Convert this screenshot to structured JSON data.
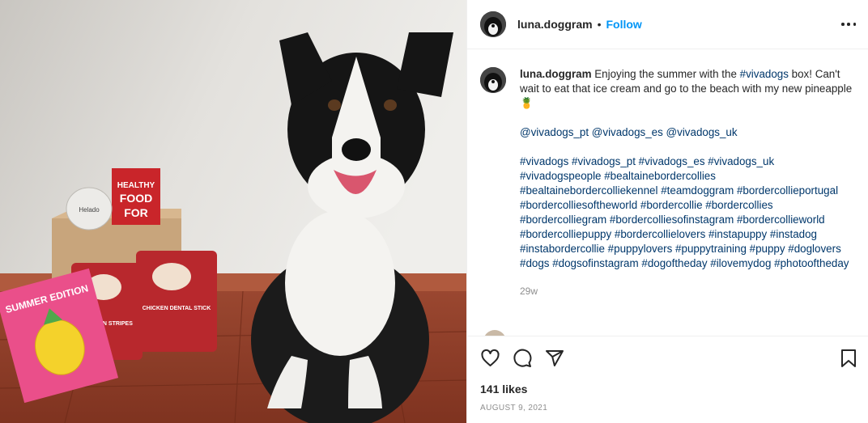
{
  "post": {
    "username": "luna.doggram",
    "separator": "•",
    "follow_label": "Follow",
    "more_label": "More options"
  },
  "caption": {
    "username": "luna.doggram",
    "text": " Enjoying the summer with the ",
    "hashtag_box": "#vivadogs",
    "text2": " box! Can't wait to eat that ice cream and go to the beach with my new pineapple 🍍",
    "mentions": "@vivadogs_pt @vivadogs_es @vivadogs_uk",
    "hashtags": "#vivadogs #vivadogs_pt #vivadogs_es #vivadogs_uk #vivadogspeople #bealtainebordercollies #bealtainebordercolliekennel #teamdoggram #bordercollieportugal #bordercolliesoftheworld #bordercollie #bordercollies #bordercolliegram #bordercolliesofinstagram #bordercollieworld #bordercolliepuppy #bordercollielovers #instapuppy #instadog #instabordercollie #puppylovers #puppytraining #puppy #doglovers #dogs #dogsofinstagram #dogoftheday #ilovemydog #photooftheday",
    "time": "29w"
  },
  "actions": {
    "likes": "141 likes",
    "date": "AUGUST 9, 2021"
  },
  "photo": {
    "box_text_1": "HEALTHY",
    "box_text_2": "FOOD",
    "box_text_3": "FOR",
    "pink_box_text": "SUMMER EDITION",
    "bag_text_1": "CHICKEN STRIPES",
    "bag_text_2": "CHICKEN DENTAL STICK",
    "ice_cream_text": "Helado"
  },
  "colors": {
    "follow": "#0095f6",
    "hashtag": "#00376b",
    "muted": "#8e8e8e"
  }
}
